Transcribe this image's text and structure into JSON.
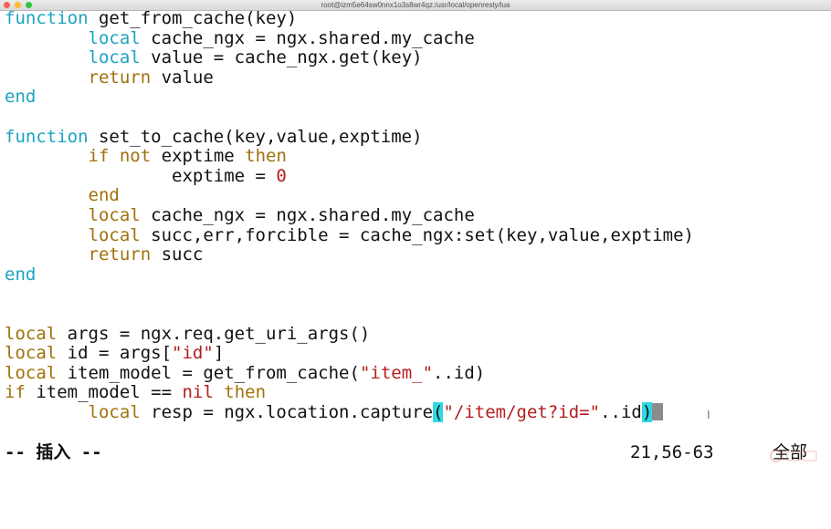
{
  "window": {
    "title": "root@izm5e64sw0nnx1o3s8wr4qz:/usr/local/openresty/lua"
  },
  "editor": {
    "lines": [
      {
        "id": "l1",
        "segs": [
          [
            "kw",
            "function"
          ],
          [
            "n",
            " get_from_cache(key)"
          ]
        ]
      },
      {
        "id": "l2",
        "segs": [
          [
            "n",
            "        "
          ],
          [
            "kw",
            "local"
          ],
          [
            "n",
            " cache_ngx = ngx.shared.my_cache"
          ]
        ]
      },
      {
        "id": "l3",
        "segs": [
          [
            "n",
            "        "
          ],
          [
            "kw",
            "local"
          ],
          [
            "n",
            " value = cache_ngx.get(key)"
          ]
        ]
      },
      {
        "id": "l4",
        "segs": [
          [
            "n",
            "        "
          ],
          [
            "lc",
            "return"
          ],
          [
            "n",
            " value"
          ]
        ]
      },
      {
        "id": "l5",
        "segs": [
          [
            "kw",
            "end"
          ]
        ]
      },
      {
        "id": "l6",
        "segs": []
      },
      {
        "id": "l7",
        "segs": [
          [
            "kw",
            "function"
          ],
          [
            "n",
            " set_to_cache(key,value,exptime)"
          ]
        ]
      },
      {
        "id": "l8",
        "segs": [
          [
            "n",
            "        "
          ],
          [
            "lc",
            "if"
          ],
          [
            "n",
            " "
          ],
          [
            "lc",
            "not"
          ],
          [
            "n",
            " exptime "
          ],
          [
            "lc",
            "then"
          ]
        ]
      },
      {
        "id": "l9",
        "segs": [
          [
            "n",
            "                exptime = "
          ],
          [
            "str",
            "0"
          ]
        ]
      },
      {
        "id": "l10",
        "segs": [
          [
            "n",
            "        "
          ],
          [
            "lc",
            "end"
          ]
        ]
      },
      {
        "id": "l11",
        "segs": [
          [
            "n",
            "        "
          ],
          [
            "lc",
            "local"
          ],
          [
            "n",
            " cache_ngx = ngx.shared.my_cache"
          ]
        ]
      },
      {
        "id": "l12",
        "segs": [
          [
            "n",
            "        "
          ],
          [
            "lc",
            "local"
          ],
          [
            "n",
            " succ,err,forcible = cache_ngx:set(key,value,exptime)"
          ]
        ]
      },
      {
        "id": "l13",
        "segs": [
          [
            "n",
            "        "
          ],
          [
            "lc",
            "return"
          ],
          [
            "n",
            " succ"
          ]
        ]
      },
      {
        "id": "l14",
        "segs": [
          [
            "kw",
            "end"
          ]
        ]
      },
      {
        "id": "l15",
        "segs": []
      },
      {
        "id": "l16",
        "segs": []
      },
      {
        "id": "l17",
        "segs": [
          [
            "lc",
            "local"
          ],
          [
            "n",
            " args = ngx.req.get_uri_args()"
          ]
        ]
      },
      {
        "id": "l18",
        "segs": [
          [
            "lc",
            "local"
          ],
          [
            "n",
            " id = args["
          ],
          [
            "str",
            "\"id\""
          ],
          [
            "n",
            "]"
          ]
        ]
      },
      {
        "id": "l19",
        "segs": [
          [
            "lc",
            "local"
          ],
          [
            "n",
            " item_model = get_from_cache("
          ],
          [
            "str",
            "\"item_\""
          ],
          [
            "n",
            "..id)"
          ]
        ]
      },
      {
        "id": "l20",
        "segs": [
          [
            "lc",
            "if"
          ],
          [
            "n",
            " item_model == "
          ],
          [
            "str",
            "nil"
          ],
          [
            "n",
            " "
          ],
          [
            "lc",
            "then"
          ]
        ]
      },
      {
        "id": "l21",
        "segs": [
          [
            "n",
            "        "
          ],
          [
            "lc",
            "local"
          ],
          [
            "n",
            " resp = ngx.location.capture"
          ],
          [
            "bm",
            "("
          ],
          [
            "str",
            "\"/item/get?id=\""
          ],
          [
            "n",
            "..id"
          ],
          [
            "bm",
            ")"
          ],
          [
            "cur",
            ""
          ]
        ]
      }
    ]
  },
  "status": {
    "mode": "-- 插入 --",
    "position": "21,56-63",
    "scroll": "全部"
  },
  "colors": {
    "keyword": "#1ba3c1",
    "statement": "#a0710b",
    "string": "#b41c1c",
    "bracket_match": "#2fd8e3",
    "cursor": "#8b8b8b"
  }
}
